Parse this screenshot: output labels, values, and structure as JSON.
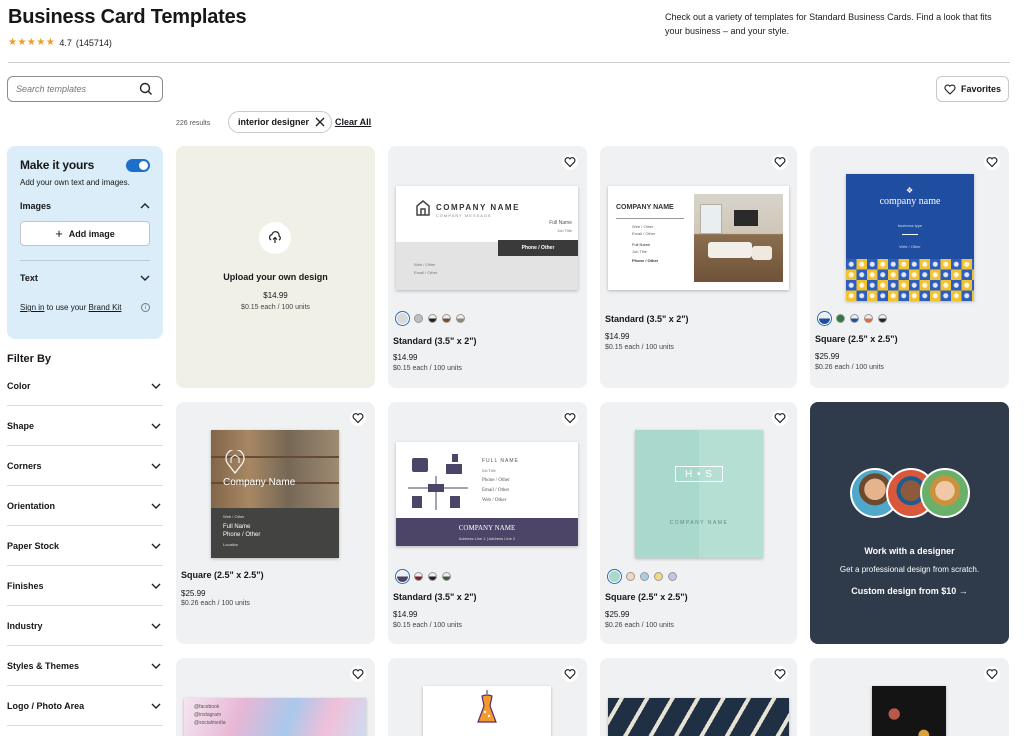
{
  "header": {
    "title": "Business Card Templates",
    "stars": "★★★★★",
    "rating": "4.7",
    "reviews": "(145714)",
    "intro": "Check out a variety of templates for Standard Business Cards. Find a look that fits your business – and your style."
  },
  "search": {
    "placeholder": "Search templates",
    "value": ""
  },
  "favorites_label": "Favorites",
  "results": {
    "count": "226 results",
    "chip": "interior designer",
    "clear_label": "Clear All"
  },
  "make_it_yours": {
    "title": "Make it yours",
    "subtitle": "Add your own text and images.",
    "images_label": "Images",
    "add_image_label": "Add image",
    "text_label": "Text",
    "sign_in": "Sign in",
    "brand_text": "to use your",
    "brand_kit": "Brand Kit"
  },
  "filter_by": "Filter By",
  "filters": [
    "Color",
    "Shape",
    "Corners",
    "Orientation",
    "Paper Stock",
    "Finishes",
    "Industry",
    "Styles & Themes",
    "Logo / Photo Area"
  ],
  "upload_card": {
    "title": "Upload your own design",
    "price": "$14.99",
    "unit": "$0.15 each / 100 units"
  },
  "cards": [
    {
      "title": "Standard (3.5\" x 2\")",
      "price": "$14.99",
      "unit": "$0.15 each / 100 units",
      "thumb_text": {
        "company": "COMPANY NAME",
        "message": "COMPANY MESSAGE",
        "full_name": "Full Name",
        "job_title": "Job Title",
        "phone": "Phone / Other",
        "web": "Web / Other",
        "email": "Email / Other"
      }
    },
    {
      "title": "Standard (3.5\" x 2\")",
      "price": "$14.99",
      "unit": "$0.15 each / 100 units",
      "thumb_text": {
        "company": "COMPANY NAME",
        "web": "Web / Other",
        "email": "Email / Other",
        "full_name": "Full Name",
        "job_title": "Job Title",
        "phone": "Phone / Other"
      }
    },
    {
      "title": "Square (2.5\" x 2.5\")",
      "price": "$25.99",
      "unit": "$0.26 each / 100 units",
      "thumb_text": {
        "company": "company name",
        "type": "business type",
        "web": "Web / Other"
      }
    },
    {
      "title": "Square (2.5\" x 2.5\")",
      "price": "$25.99",
      "unit": "$0.26 each / 100 units",
      "thumb_text": {
        "company": "Company Name",
        "web": "Web / Other",
        "full_name": "Full Name",
        "phone": "Phone / Other",
        "location": "Location"
      }
    },
    {
      "title": "Standard (3.5\" x 2\")",
      "price": "$14.99",
      "unit": "$0.15 each / 100 units",
      "thumb_text": {
        "full_name": "FULL NAME",
        "job_title": "Job Title",
        "phone": "Phone / Other",
        "email": "Email / Other",
        "web": "Web / Other",
        "company": "COMPANY NAME",
        "address": "Address Line 1 | Address Line 2"
      }
    },
    {
      "title": "Square (2.5\" x 2.5\")",
      "price": "$25.99",
      "unit": "$0.26 each / 100 units",
      "thumb_text": {
        "monogram": "H • S",
        "company": "COMPANY NAME"
      }
    }
  ],
  "designer_card": {
    "title": "Work with a designer",
    "subtitle": "Get a professional design from scratch.",
    "link": "Custom design from $10 →"
  },
  "bottom_thumb_text": {
    "facebook": "@facebook",
    "instagram": "@instagram",
    "socialmedia": "@socialmedia"
  },
  "colors": {
    "accent": "#1c70c9",
    "stars": "#f39b1f",
    "panel": "#dbedf8",
    "designer_bg": "#2f3a4b"
  }
}
